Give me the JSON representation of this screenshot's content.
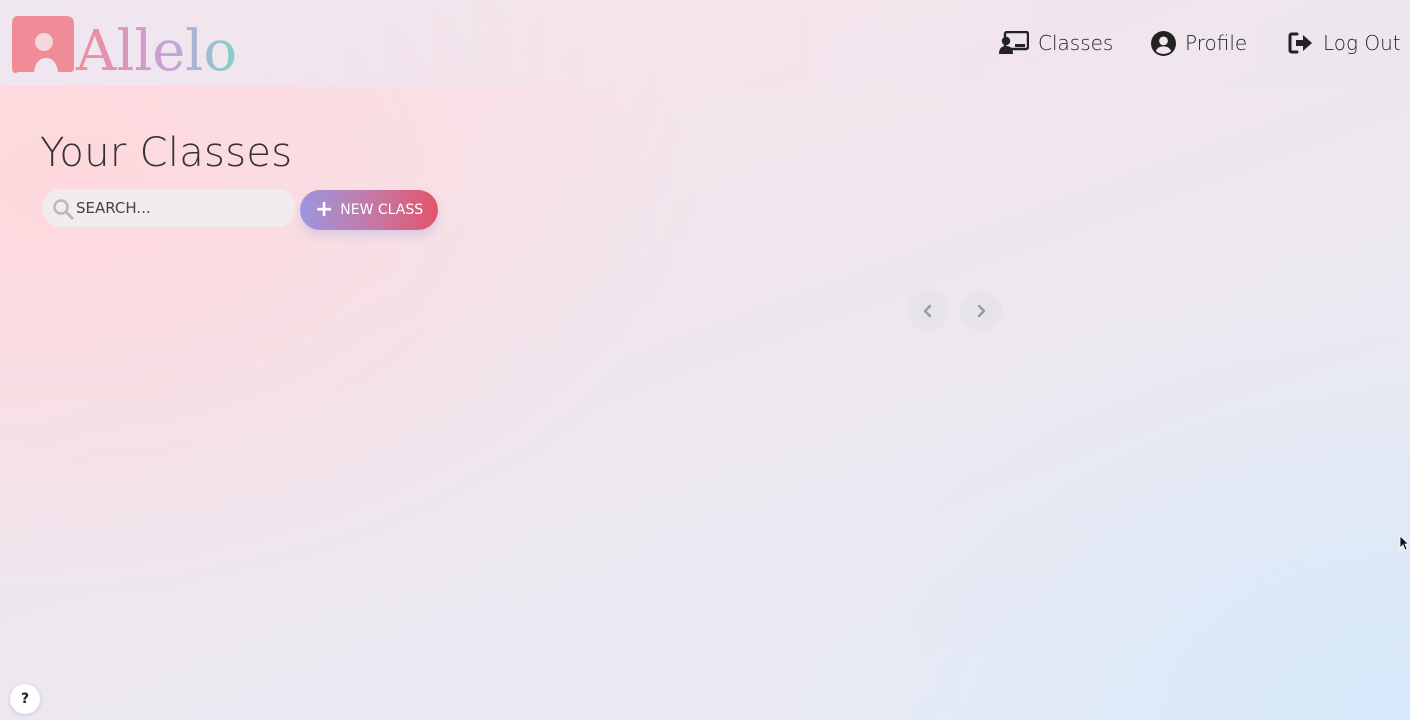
{
  "header": {
    "logo_text": "Allelo",
    "nav": [
      {
        "label": "Classes",
        "icon": "classes-icon"
      },
      {
        "label": "Profile",
        "icon": "user-circle-icon"
      },
      {
        "label": "Log Out",
        "icon": "logout-icon"
      }
    ]
  },
  "main": {
    "title": "Your Classes",
    "search": {
      "placeholder": "SEARCH...",
      "value": "",
      "icon": "search-icon"
    },
    "new_class": {
      "label": "NEW CLASS",
      "icon": "plus-icon"
    },
    "carousel": {
      "prev_icon": "chevron-left-icon",
      "next_icon": "chevron-right-icon"
    }
  },
  "help": {
    "label": "?"
  },
  "colors": {
    "logo_pink": "#f08c98",
    "logo_teal": "#7fd3c8",
    "button_start": "#9d95e0",
    "button_end": "#e2546b",
    "text_dark": "#222222"
  }
}
